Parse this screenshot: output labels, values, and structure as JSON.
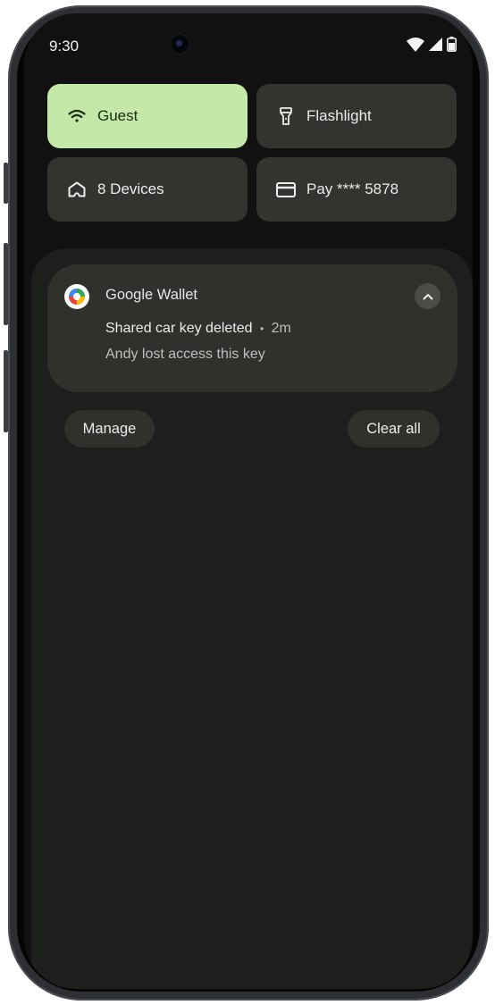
{
  "status_bar": {
    "time": "9:30"
  },
  "tiles": [
    {
      "label": "Guest",
      "icon": "wifi-icon",
      "active": true
    },
    {
      "label": "Flashlight",
      "icon": "flashlight-icon",
      "active": false
    },
    {
      "label": "8 Devices",
      "icon": "home-icon",
      "active": false
    },
    {
      "label": "Pay **** 5878",
      "icon": "card-icon",
      "active": false
    }
  ],
  "notification": {
    "app_name": "Google Wallet",
    "title": "Shared car key deleted",
    "separator": "•",
    "time": "2m",
    "body": "Andy lost access this key"
  },
  "actions": {
    "manage": "Manage",
    "clear_all": "Clear all"
  },
  "colors": {
    "active_tile": "#c3e8a8",
    "tile": "#33342f",
    "shade": "#1d1f1c",
    "card": "#2f312c"
  }
}
